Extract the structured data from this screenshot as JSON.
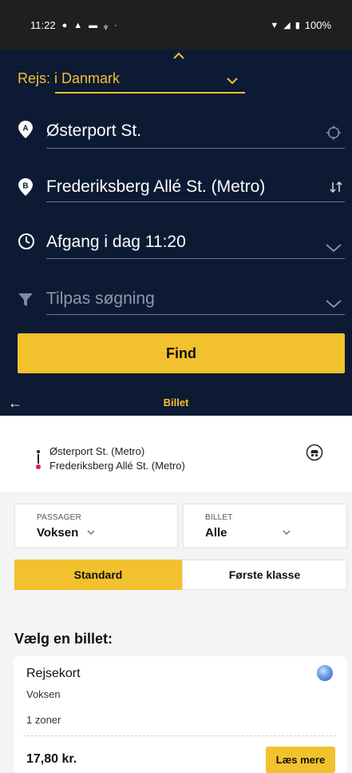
{
  "status_bar": {
    "time": "11:22",
    "battery": "100%"
  },
  "planner": {
    "journey_label": "Rejs: i Danmark",
    "from": "Østerport St.",
    "to": "Frederiksberg Allé St. (Metro)",
    "departure": "Afgang  i dag  11:20",
    "filter_placeholder": "Tilpas søgning",
    "find_label": "Find",
    "accent_color": "#f2c12e",
    "background_color": "#0d1a33"
  },
  "tabbar": {
    "title": "Billet"
  },
  "route": {
    "from": "Østerport St. (Metro)",
    "to": "Frederiksberg Allé St. (Metro)"
  },
  "selectors": {
    "passenger": {
      "label": "PASSAGER",
      "value": "Voksen"
    },
    "ticket": {
      "label": "BILLET",
      "value": "Alle"
    }
  },
  "segments": {
    "standard": "Standard",
    "first": "Første klasse",
    "active": "standard"
  },
  "tickets": {
    "heading": "Vælg en billet:",
    "items": [
      {
        "name": "Rejsekort",
        "passenger": "Voksen",
        "zones": "1 zoner",
        "price": "17,80 kr.",
        "more_label": "Læs mere"
      }
    ]
  }
}
